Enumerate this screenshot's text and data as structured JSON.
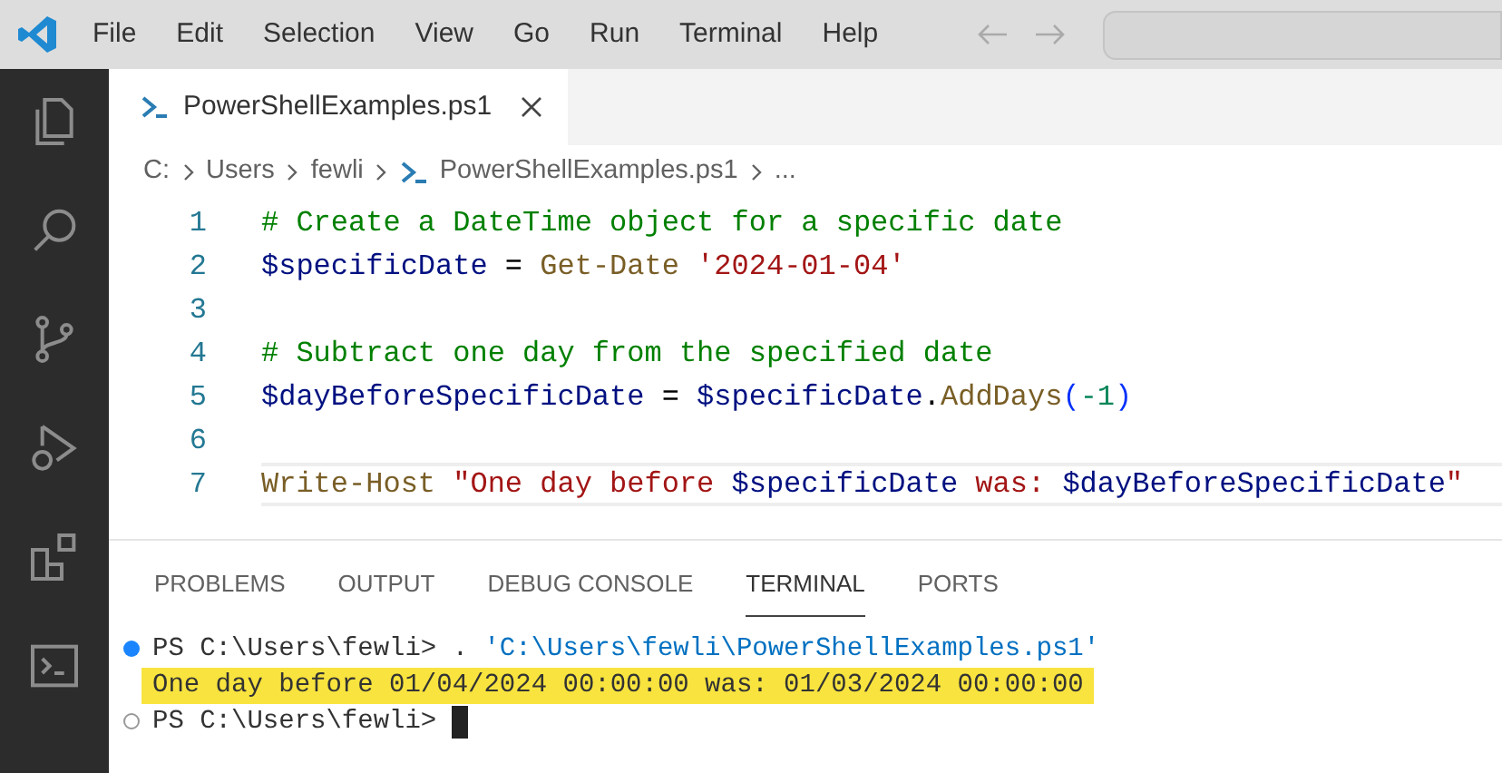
{
  "menu_bar": {
    "items": [
      "File",
      "Edit",
      "Selection",
      "View",
      "Go",
      "Run",
      "Terminal",
      "Help"
    ]
  },
  "activity_bar": {
    "items": [
      {
        "kind": "files",
        "selected": false
      },
      {
        "kind": "search",
        "selected": false
      },
      {
        "kind": "source-control",
        "selected": false
      },
      {
        "kind": "run-debug",
        "selected": false
      },
      {
        "kind": "extensions",
        "selected": false
      },
      {
        "kind": "terminal",
        "selected": false
      }
    ]
  },
  "editor_tabs": [
    {
      "label": "PowerShellExamples.ps1",
      "selected": true
    }
  ],
  "breadcrumbs": [
    {
      "label": "C:",
      "kind": "folder"
    },
    {
      "label": "Users",
      "kind": "folder"
    },
    {
      "label": "fewli",
      "kind": "folder"
    },
    {
      "label": "PowerShellExamples.ps1",
      "kind": "file"
    },
    {
      "label": "...",
      "kind": "more"
    }
  ],
  "code_lines": [
    {
      "number": "1",
      "current": false,
      "tokens": [
        {
          "text": "# Create a DateTime object for a specific date",
          "kind": "comment"
        }
      ]
    },
    {
      "number": "2",
      "current": false,
      "tokens": [
        {
          "text": "$specificDate",
          "kind": "variable"
        },
        {
          "text": " = ",
          "kind": "plain"
        },
        {
          "text": "Get-Date",
          "kind": "command"
        },
        {
          "text": " '2024-01-04'",
          "kind": "string"
        }
      ]
    },
    {
      "number": "3",
      "current": false
    },
    {
      "number": "4",
      "current": false,
      "tokens": [
        {
          "text": "# Subtract one day from the specified date",
          "kind": "comment"
        }
      ]
    },
    {
      "number": "5",
      "current": false,
      "tokens": [
        {
          "text": "$dayBeforeSpecificDate",
          "kind": "variable"
        },
        {
          "text": " = ",
          "kind": "plain"
        },
        {
          "text": "$specificDate",
          "kind": "variable"
        },
        {
          "text": ".",
          "kind": "plain"
        },
        {
          "text": "AddDays",
          "kind": "command"
        },
        {
          "text": "(",
          "kind": "bracket"
        },
        {
          "text": "-1",
          "kind": "number"
        },
        {
          "text": ")",
          "kind": "bracket"
        }
      ]
    },
    {
      "number": "6",
      "current": false
    },
    {
      "number": "7",
      "current": true,
      "tokens": [
        {
          "text": "Write-Host",
          "kind": "command"
        },
        {
          "text": " \"One day before ",
          "kind": "string"
        },
        {
          "text": "$specificDate",
          "kind": "variable"
        },
        {
          "text": " was: ",
          "kind": "string"
        },
        {
          "text": "$dayBeforeSpecificDate",
          "kind": "variable"
        },
        {
          "text": "\"",
          "kind": "string"
        }
      ]
    }
  ],
  "panel_tabs": [
    {
      "label": "PROBLEMS",
      "selected": false
    },
    {
      "label": "OUTPUT",
      "selected": false
    },
    {
      "label": "DEBUG CONSOLE",
      "selected": false
    },
    {
      "label": "TERMINAL",
      "selected": true
    },
    {
      "label": "PORTS",
      "selected": false
    }
  ],
  "terminal_lines": [
    {
      "kind": "completed",
      "highlighted": false,
      "cursor": false,
      "tokens": [
        {
          "text": "PS C:\\Users\\fewli> . ",
          "kind": "plain"
        },
        {
          "text": "'C:\\Users\\fewli\\PowerShellExamples.ps1'",
          "kind": "path"
        }
      ]
    },
    {
      "kind": "output",
      "highlighted": true,
      "cursor": false,
      "tokens": [
        {
          "text": "One day before 01/04/2024 00:00:00 was: 01/03/2024 00:00:00",
          "kind": "plain"
        }
      ]
    },
    {
      "kind": "current",
      "highlighted": false,
      "cursor": true,
      "tokens": [
        {
          "text": "PS C:\\Users\\fewli> ",
          "kind": "plain"
        }
      ]
    }
  ]
}
